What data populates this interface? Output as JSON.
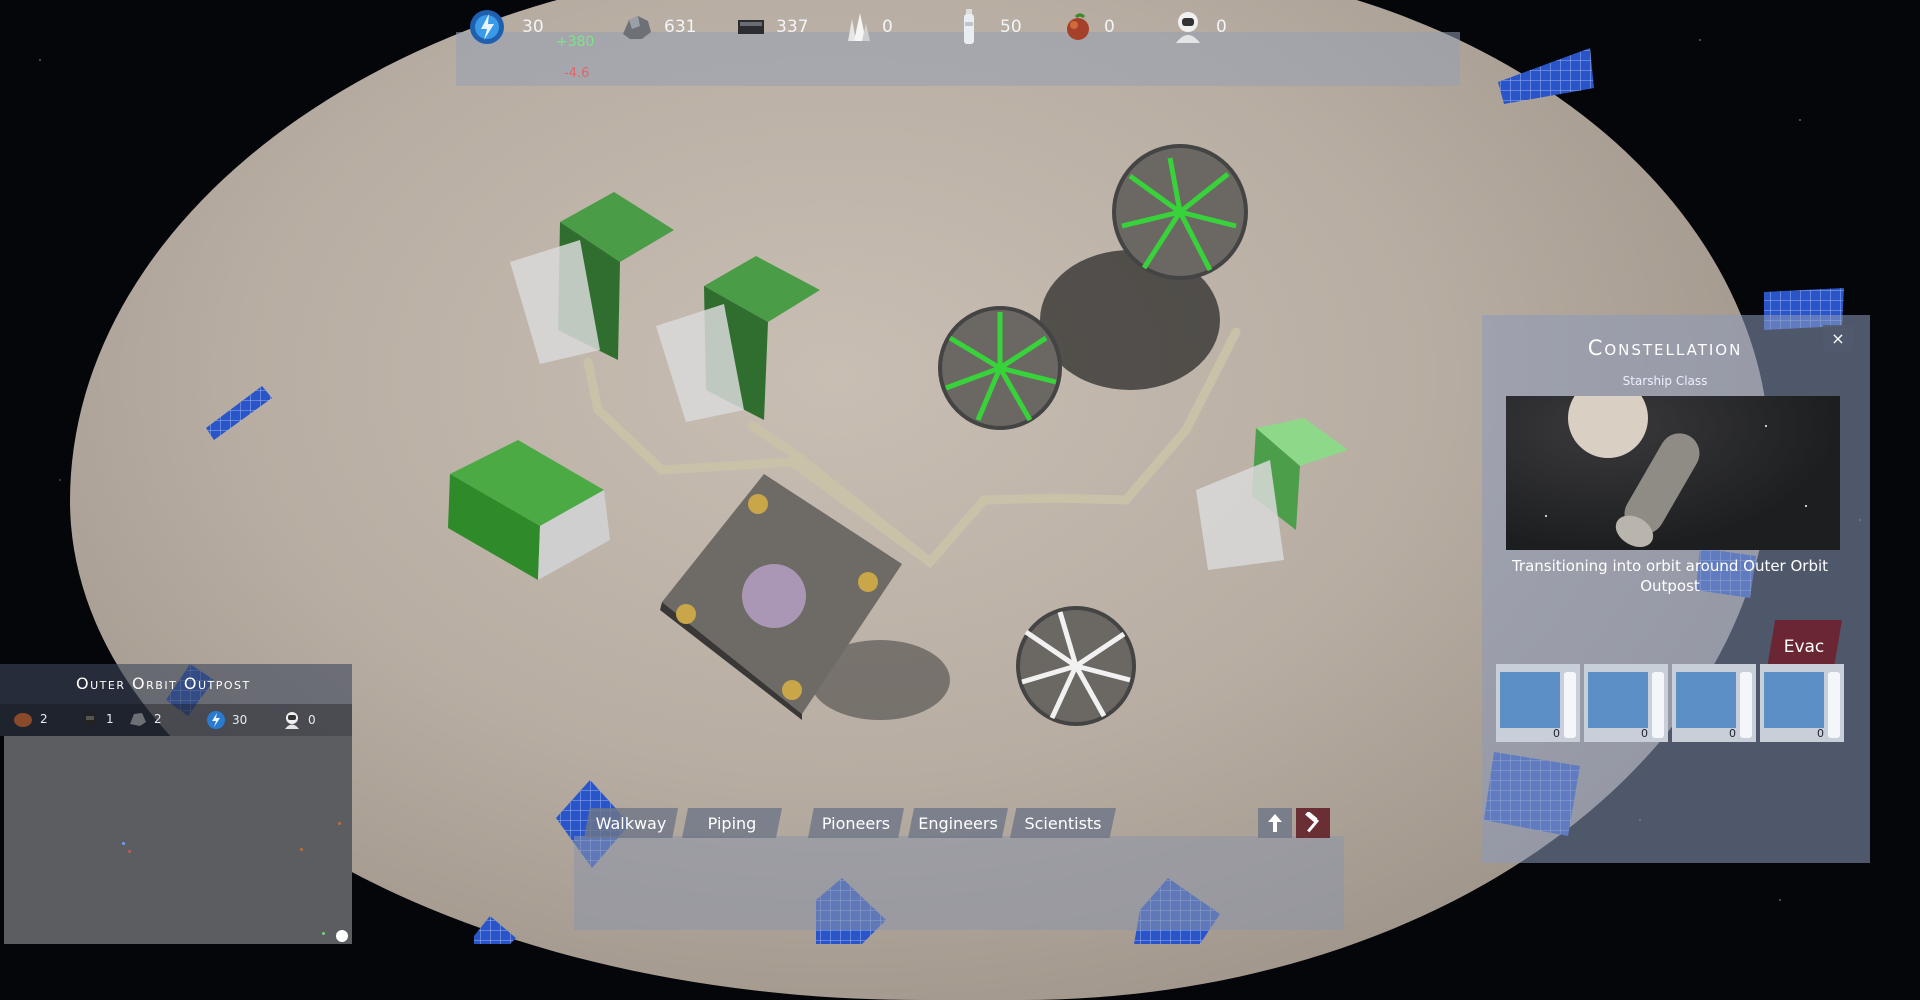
{
  "colors": {
    "ui_panel": "#96a0b4",
    "gain": "#7fe28c",
    "loss": "#e2646a",
    "evac": "#6a2633",
    "building_green": "#3c8f3c"
  },
  "resources": [
    {
      "icon": "energy-orb-icon",
      "value": "30"
    },
    {
      "icon": "ore-rock-icon",
      "value": "631"
    },
    {
      "icon": "metal-bar-icon",
      "value": "337"
    },
    {
      "icon": "crystal-icon",
      "value": "0"
    },
    {
      "icon": "water-bottle-icon",
      "value": "50"
    },
    {
      "icon": "food-icon",
      "value": "0"
    },
    {
      "icon": "astronaut-icon",
      "value": "0"
    }
  ],
  "energy_delta": {
    "gain": "+380",
    "loss": "-4.6"
  },
  "minimap": {
    "title": "Outer Orbit Outpost",
    "stats": [
      {
        "icon": "pioneer-icon",
        "value": "2"
      },
      {
        "icon": "engineer-icon",
        "value": "1"
      },
      {
        "icon": "scientist-icon",
        "value": "2"
      },
      {
        "icon": "energy-orb-icon",
        "value": "30"
      },
      {
        "icon": "astronaut-icon",
        "value": "0"
      }
    ]
  },
  "build_tabs": [
    "Walkway",
    "Piping",
    "Pioneers",
    "Engineers",
    "Scientists"
  ],
  "build_tools": [
    {
      "icon": "arrow-up-icon"
    },
    {
      "icon": "hammer-icon"
    }
  ],
  "ship_panel": {
    "close": "×",
    "title": "Constellation",
    "subtitle": "Starship Class",
    "status": "Transitioning into orbit around Outer Orbit Outpost",
    "evac": "Evac",
    "slots": [
      "0",
      "0",
      "0",
      "0"
    ]
  }
}
